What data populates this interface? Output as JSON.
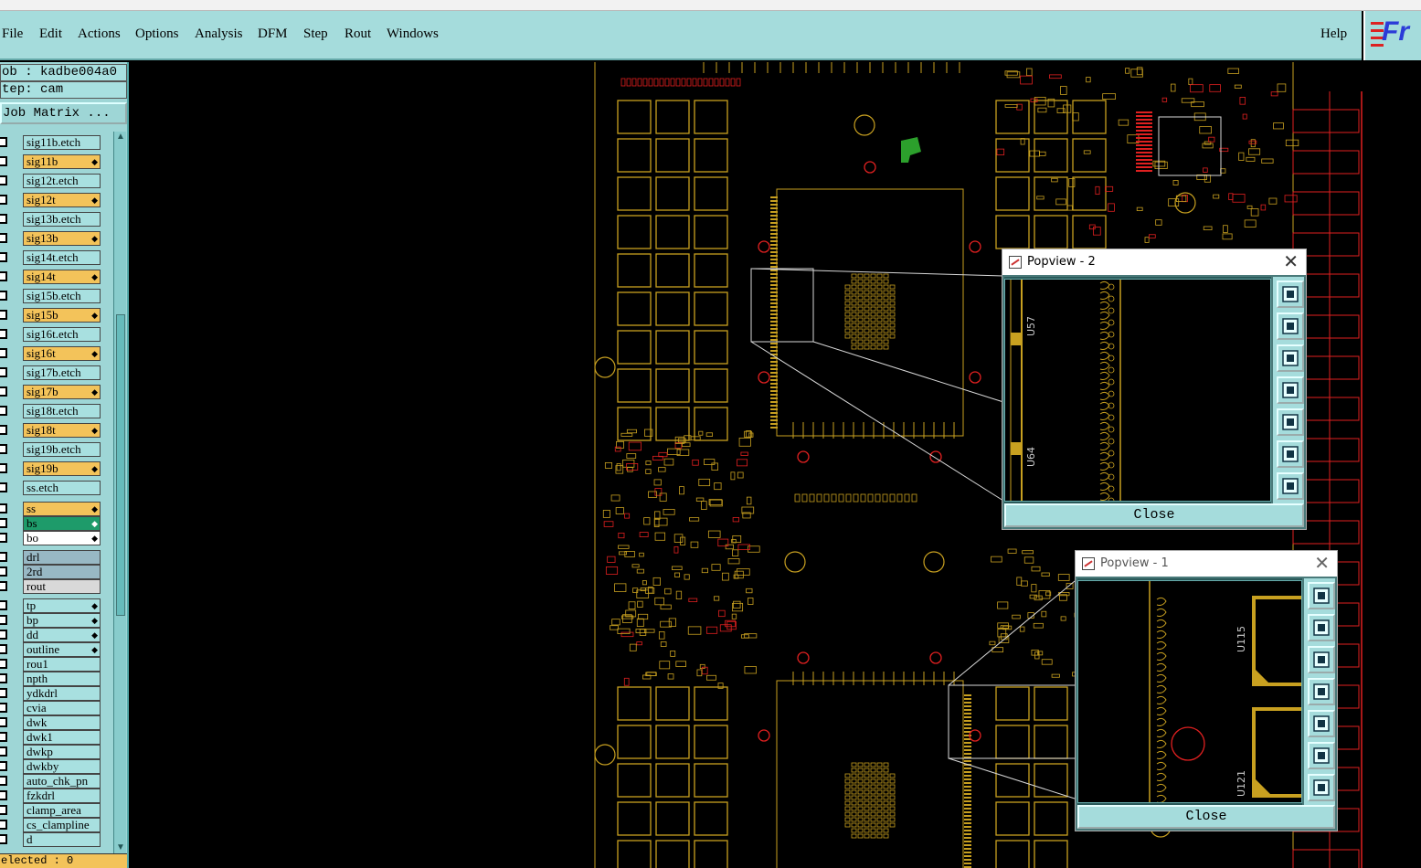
{
  "menubar": {
    "items": [
      "File",
      "Edit",
      "Actions",
      "Options",
      "Analysis",
      "DFM",
      "Step",
      "Rout",
      "Windows"
    ],
    "help": "Help",
    "logo_text": "Fr"
  },
  "left_panel": {
    "job": "ob : kadbe004a0",
    "step": "tep: cam",
    "job_matrix": "Job Matrix ...",
    "selected": "elected : 0"
  },
  "layers": [
    {
      "name": "sig11b.etch",
      "color": "#a8e0e0",
      "flag": ""
    },
    {
      "name": "sig11b",
      "color": "#f3c35a",
      "flag": "◆"
    },
    {
      "name": "sig12t.etch",
      "color": "#a8e0e0",
      "flag": ""
    },
    {
      "name": "sig12t",
      "color": "#f3c35a",
      "flag": "◆"
    },
    {
      "name": "sig13b.etch",
      "color": "#a8e0e0",
      "flag": ""
    },
    {
      "name": "sig13b",
      "color": "#f3c35a",
      "flag": "◆"
    },
    {
      "name": "sig14t.etch",
      "color": "#a8e0e0",
      "flag": ""
    },
    {
      "name": "sig14t",
      "color": "#f3c35a",
      "flag": "◆"
    },
    {
      "name": "sig15b.etch",
      "color": "#a8e0e0",
      "flag": ""
    },
    {
      "name": "sig15b",
      "color": "#f3c35a",
      "flag": "◆"
    },
    {
      "name": "sig16t.etch",
      "color": "#a8e0e0",
      "flag": ""
    },
    {
      "name": "sig16t",
      "color": "#f3c35a",
      "flag": "◆"
    },
    {
      "name": "sig17b.etch",
      "color": "#a8e0e0",
      "flag": ""
    },
    {
      "name": "sig17b",
      "color": "#f3c35a",
      "flag": "◆"
    },
    {
      "name": "sig18t.etch",
      "color": "#a8e0e0",
      "flag": ""
    },
    {
      "name": "sig18t",
      "color": "#f3c35a",
      "flag": "◆"
    },
    {
      "name": "sig19b.etch",
      "color": "#a8e0e0",
      "flag": ""
    },
    {
      "name": "sig19b",
      "color": "#f3c35a",
      "flag": "◆"
    },
    {
      "name": "ss.etch",
      "color": "#a8e0e0",
      "flag": ""
    },
    {
      "name": "ss",
      "color": "#f3c35a",
      "flag": "◆"
    },
    {
      "name": "bs",
      "color": "#1e9b6a",
      "flag": "◆"
    },
    {
      "name": "bo",
      "color": "#ffffff",
      "flag": "◆"
    },
    {
      "name": "drl",
      "color": "#98b8c4",
      "flag": ""
    },
    {
      "name": "2rd",
      "color": "#98b8c4",
      "flag": ""
    },
    {
      "name": "rout",
      "color": "#d9d9d9",
      "flag": ""
    },
    {
      "name": "tp",
      "color": "#a8e0e0",
      "flag": "◆"
    },
    {
      "name": "bp",
      "color": "#a8e0e0",
      "flag": "◆"
    },
    {
      "name": "dd",
      "color": "#a8e0e0",
      "flag": "◆"
    },
    {
      "name": "outline",
      "color": "#a8e0e0",
      "flag": "◆"
    },
    {
      "name": "rou1",
      "color": "#a8e0e0",
      "flag": ""
    },
    {
      "name": "npth",
      "color": "#a8e0e0",
      "flag": ""
    },
    {
      "name": "ydkdrl",
      "color": "#a8e0e0",
      "flag": ""
    },
    {
      "name": "cvia",
      "color": "#a8e0e0",
      "flag": ""
    },
    {
      "name": "dwk",
      "color": "#a8e0e0",
      "flag": ""
    },
    {
      "name": "dwk1",
      "color": "#a8e0e0",
      "flag": ""
    },
    {
      "name": "dwkp",
      "color": "#a8e0e0",
      "flag": ""
    },
    {
      "name": "dwkby",
      "color": "#a8e0e0",
      "flag": ""
    },
    {
      "name": "auto_chk_pn",
      "color": "#a8e0e0",
      "flag": ""
    },
    {
      "name": "fzkdrl",
      "color": "#a8e0e0",
      "flag": ""
    },
    {
      "name": "clamp_area",
      "color": "#a8e0e0",
      "flag": ""
    },
    {
      "name": "cs_clampline",
      "color": "#a8e0e0",
      "flag": ""
    },
    {
      "name": "d",
      "color": "#a8e0e0",
      "flag": ""
    }
  ],
  "popviews": [
    {
      "title": "Popview - 2",
      "close_label": "Close",
      "refs": [
        "U57",
        "U64"
      ]
    },
    {
      "title": "Popview - 1",
      "close_label": "Close",
      "refs": [
        "U115",
        "U121"
      ]
    }
  ],
  "board": {
    "trace_color": "#c8a020",
    "drill_color": "#e02020",
    "silk_color": "#d8d8d8",
    "green_color": "#2ca02c"
  }
}
